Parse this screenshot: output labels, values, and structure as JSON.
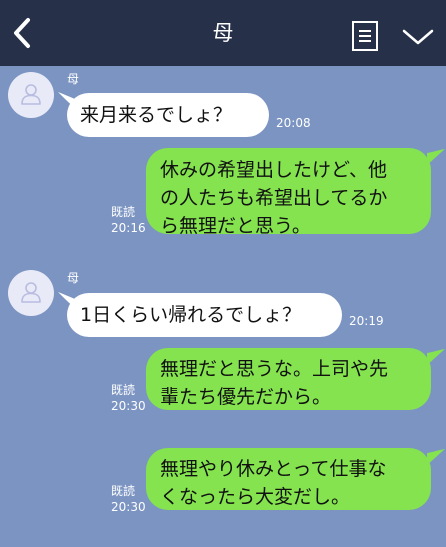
{
  "header": {
    "title": "母"
  },
  "messages": [
    {
      "sender": "母",
      "text": "来月来るでしょ？",
      "time": "20:08"
    },
    {
      "lines": [
        "休みの希望出したけど、他",
        "の人たちも希望出してるか",
        "ら無理だと思う。"
      ],
      "read": "既読",
      "time": "20:16"
    },
    {
      "sender": "母",
      "text": "1日くらい帰れるでしょ？",
      "time": "20:19"
    },
    {
      "lines": [
        "無理だと思うな。上司や先",
        "輩たち優先だから。"
      ],
      "read": "既読",
      "time": "20:30"
    },
    {
      "lines": [
        "無理やり休みとって仕事な",
        "くなったら大変だし。"
      ],
      "read": "既読",
      "time": "20:30"
    }
  ],
  "colors": {
    "background": "#7b94c2",
    "header": "#263049",
    "outgoing_bubble": "#84e34e",
    "incoming_bubble": "#ffffff"
  },
  "icons": {
    "back": "chevron-left-icon",
    "notes": "notes-icon",
    "menu": "chevron-down-icon",
    "avatar": "person-icon"
  }
}
